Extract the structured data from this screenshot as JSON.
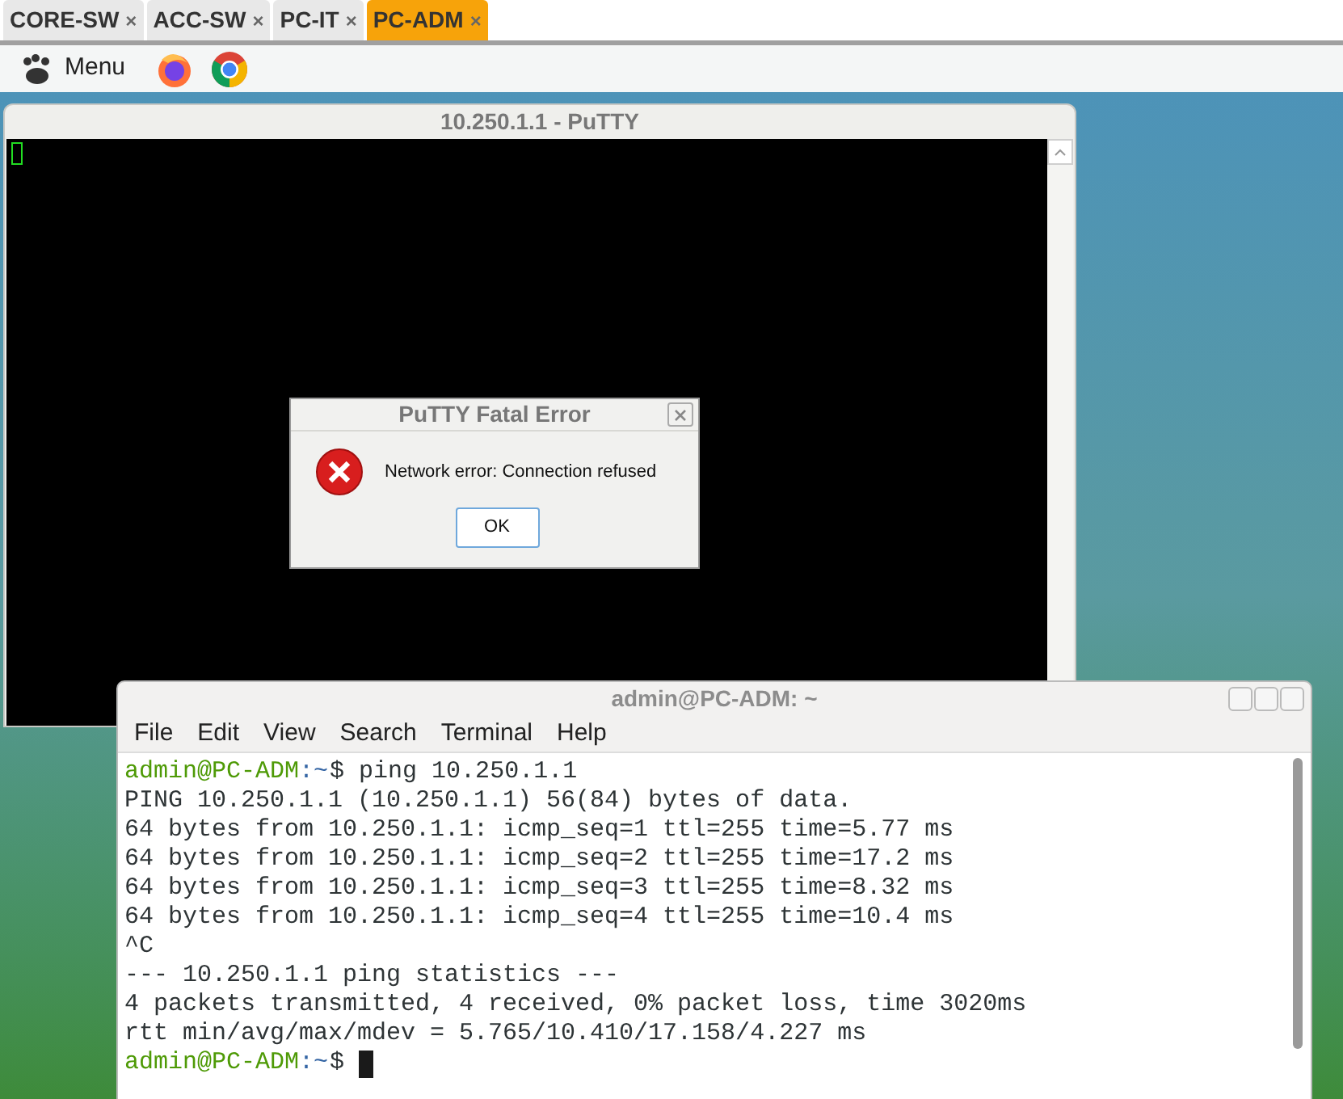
{
  "tabs": [
    {
      "label": "CORE-SW",
      "close": "×",
      "selected": false
    },
    {
      "label": "ACC-SW",
      "close": "×",
      "selected": false
    },
    {
      "label": "PC-IT",
      "close": "×",
      "selected": false
    },
    {
      "label": "PC-ADM",
      "close": "×",
      "selected": true
    }
  ],
  "panel": {
    "menu_label": "Menu"
  },
  "putty": {
    "title": "10.250.1.1 - PuTTY",
    "dialog": {
      "title": "PuTTY Fatal Error",
      "message": "Network error: Connection refused",
      "button": "OK"
    }
  },
  "terminal": {
    "title": "admin@PC-ADM: ~",
    "menu": [
      "File",
      "Edit",
      "View",
      "Search",
      "Terminal",
      "Help"
    ],
    "lines": [
      {
        "kind": "prompt",
        "user": "admin@PC-ADM",
        "path": ":~",
        "command": "$ ping 10.250.1.1",
        "cursor": false
      },
      {
        "kind": "output",
        "text": "PING 10.250.1.1 (10.250.1.1) 56(84) bytes of data."
      },
      {
        "kind": "output",
        "text": "64 bytes from 10.250.1.1: icmp_seq=1 ttl=255 time=5.77 ms"
      },
      {
        "kind": "output",
        "text": "64 bytes from 10.250.1.1: icmp_seq=2 ttl=255 time=17.2 ms"
      },
      {
        "kind": "output",
        "text": "64 bytes from 10.250.1.1: icmp_seq=3 ttl=255 time=8.32 ms"
      },
      {
        "kind": "output",
        "text": "64 bytes from 10.250.1.1: icmp_seq=4 ttl=255 time=10.4 ms"
      },
      {
        "kind": "output",
        "text": "^C"
      },
      {
        "kind": "output",
        "text": "--- 10.250.1.1 ping statistics ---"
      },
      {
        "kind": "output",
        "text": "4 packets transmitted, 4 received, 0% packet loss, time 3020ms"
      },
      {
        "kind": "output",
        "text": "rtt min/avg/max/mdev = 5.765/10.410/17.158/4.227 ms"
      },
      {
        "kind": "prompt",
        "user": "admin@PC-ADM",
        "path": ":~",
        "command": "$",
        "cursor": true
      }
    ]
  }
}
